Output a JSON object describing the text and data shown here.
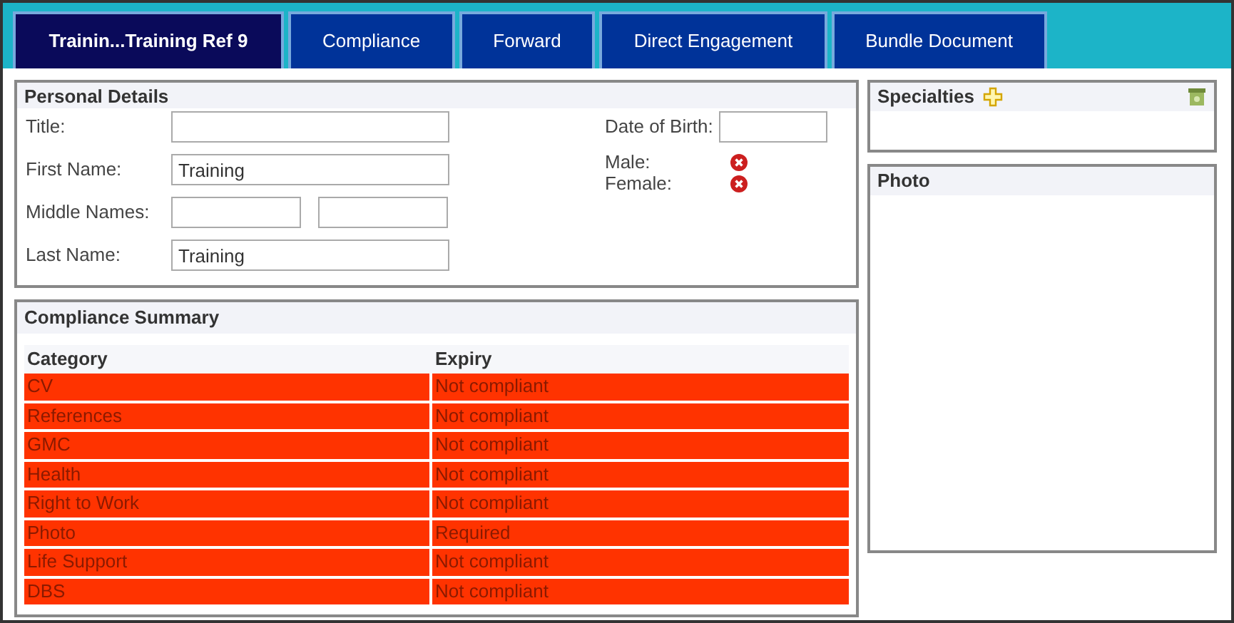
{
  "tabs": [
    {
      "label": "Trainin...Training Ref 9",
      "selected": true
    },
    {
      "label": "Compliance",
      "selected": false
    },
    {
      "label": "Forward",
      "selected": false
    },
    {
      "label": "Direct Engagement",
      "selected": false
    },
    {
      "label": "Bundle Document",
      "selected": false
    }
  ],
  "personal_details": {
    "title": "Personal Details",
    "fields": [
      {
        "label": "Title:",
        "kind": "single"
      },
      {
        "label": "First Name:",
        "kind": "single",
        "value": "Training"
      },
      {
        "label": "Middle Names:",
        "kind": "double"
      },
      {
        "label": "Last Name:",
        "kind": "single",
        "value": "Training"
      }
    ],
    "date_of_birth": {
      "label": "Date of Birth:"
    },
    "genders": [
      {
        "label": "Male:"
      },
      {
        "label": "Female:"
      }
    ]
  },
  "compliance_summary": {
    "title": "Compliance Summary",
    "columns": [
      "Category",
      "Expiry"
    ],
    "rows": [
      [
        "CV",
        "Not compliant"
      ],
      [
        "References",
        "Not compliant"
      ],
      [
        "GMC",
        "Not compliant"
      ],
      [
        "Health",
        "Not compliant"
      ],
      [
        "Right to Work",
        "Not compliant"
      ],
      [
        "Photo",
        "Required"
      ],
      [
        "Life Support",
        "Not compliant"
      ],
      [
        "DBS",
        "Not compliant"
      ]
    ]
  },
  "specialties": {
    "title": "Specialties"
  },
  "photo": {
    "title": "Photo"
  }
}
